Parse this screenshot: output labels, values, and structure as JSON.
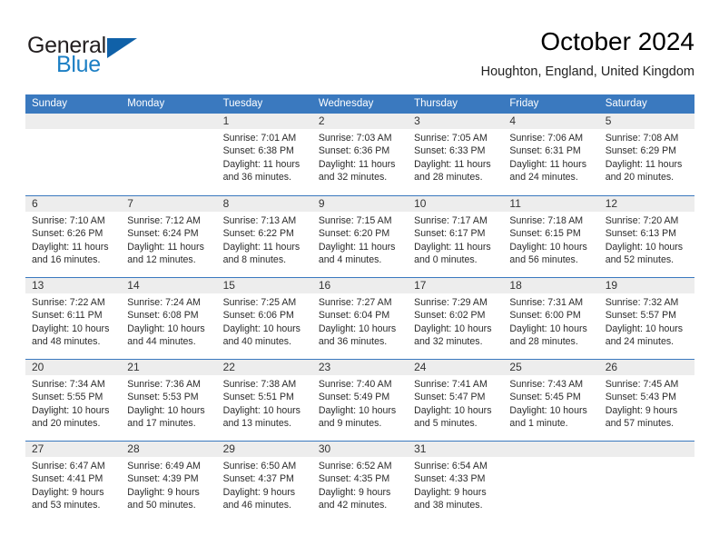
{
  "logo": {
    "word_top": "General",
    "word_bottom": "Blue",
    "triangle_color": "#1061a8",
    "blue_color": "#1c7fc4",
    "dark_color": "#231f20"
  },
  "header": {
    "title": "October 2024",
    "subtitle": "Houghton, England, United Kingdom"
  },
  "theme": {
    "header_blue": "#3a79bf",
    "day_band_gray": "#ededed",
    "text_color": "#2b2b2b"
  },
  "calendar": {
    "weekdays": [
      "Sunday",
      "Monday",
      "Tuesday",
      "Wednesday",
      "Thursday",
      "Friday",
      "Saturday"
    ],
    "weeks": [
      [
        {
          "day": "",
          "empty": true,
          "lines": []
        },
        {
          "day": "",
          "empty": true,
          "lines": []
        },
        {
          "day": "1",
          "empty": false,
          "lines": [
            "Sunrise: 7:01 AM",
            "Sunset: 6:38 PM",
            "Daylight: 11 hours",
            "and 36 minutes."
          ]
        },
        {
          "day": "2",
          "empty": false,
          "lines": [
            "Sunrise: 7:03 AM",
            "Sunset: 6:36 PM",
            "Daylight: 11 hours",
            "and 32 minutes."
          ]
        },
        {
          "day": "3",
          "empty": false,
          "lines": [
            "Sunrise: 7:05 AM",
            "Sunset: 6:33 PM",
            "Daylight: 11 hours",
            "and 28 minutes."
          ]
        },
        {
          "day": "4",
          "empty": false,
          "lines": [
            "Sunrise: 7:06 AM",
            "Sunset: 6:31 PM",
            "Daylight: 11 hours",
            "and 24 minutes."
          ]
        },
        {
          "day": "5",
          "empty": false,
          "lines": [
            "Sunrise: 7:08 AM",
            "Sunset: 6:29 PM",
            "Daylight: 11 hours",
            "and 20 minutes."
          ]
        }
      ],
      [
        {
          "day": "6",
          "empty": false,
          "lines": [
            "Sunrise: 7:10 AM",
            "Sunset: 6:26 PM",
            "Daylight: 11 hours",
            "and 16 minutes."
          ]
        },
        {
          "day": "7",
          "empty": false,
          "lines": [
            "Sunrise: 7:12 AM",
            "Sunset: 6:24 PM",
            "Daylight: 11 hours",
            "and 12 minutes."
          ]
        },
        {
          "day": "8",
          "empty": false,
          "lines": [
            "Sunrise: 7:13 AM",
            "Sunset: 6:22 PM",
            "Daylight: 11 hours",
            "and 8 minutes."
          ]
        },
        {
          "day": "9",
          "empty": false,
          "lines": [
            "Sunrise: 7:15 AM",
            "Sunset: 6:20 PM",
            "Daylight: 11 hours",
            "and 4 minutes."
          ]
        },
        {
          "day": "10",
          "empty": false,
          "lines": [
            "Sunrise: 7:17 AM",
            "Sunset: 6:17 PM",
            "Daylight: 11 hours",
            "and 0 minutes."
          ]
        },
        {
          "day": "11",
          "empty": false,
          "lines": [
            "Sunrise: 7:18 AM",
            "Sunset: 6:15 PM",
            "Daylight: 10 hours",
            "and 56 minutes."
          ]
        },
        {
          "day": "12",
          "empty": false,
          "lines": [
            "Sunrise: 7:20 AM",
            "Sunset: 6:13 PM",
            "Daylight: 10 hours",
            "and 52 minutes."
          ]
        }
      ],
      [
        {
          "day": "13",
          "empty": false,
          "lines": [
            "Sunrise: 7:22 AM",
            "Sunset: 6:11 PM",
            "Daylight: 10 hours",
            "and 48 minutes."
          ]
        },
        {
          "day": "14",
          "empty": false,
          "lines": [
            "Sunrise: 7:24 AM",
            "Sunset: 6:08 PM",
            "Daylight: 10 hours",
            "and 44 minutes."
          ]
        },
        {
          "day": "15",
          "empty": false,
          "lines": [
            "Sunrise: 7:25 AM",
            "Sunset: 6:06 PM",
            "Daylight: 10 hours",
            "and 40 minutes."
          ]
        },
        {
          "day": "16",
          "empty": false,
          "lines": [
            "Sunrise: 7:27 AM",
            "Sunset: 6:04 PM",
            "Daylight: 10 hours",
            "and 36 minutes."
          ]
        },
        {
          "day": "17",
          "empty": false,
          "lines": [
            "Sunrise: 7:29 AM",
            "Sunset: 6:02 PM",
            "Daylight: 10 hours",
            "and 32 minutes."
          ]
        },
        {
          "day": "18",
          "empty": false,
          "lines": [
            "Sunrise: 7:31 AM",
            "Sunset: 6:00 PM",
            "Daylight: 10 hours",
            "and 28 minutes."
          ]
        },
        {
          "day": "19",
          "empty": false,
          "lines": [
            "Sunrise: 7:32 AM",
            "Sunset: 5:57 PM",
            "Daylight: 10 hours",
            "and 24 minutes."
          ]
        }
      ],
      [
        {
          "day": "20",
          "empty": false,
          "lines": [
            "Sunrise: 7:34 AM",
            "Sunset: 5:55 PM",
            "Daylight: 10 hours",
            "and 20 minutes."
          ]
        },
        {
          "day": "21",
          "empty": false,
          "lines": [
            "Sunrise: 7:36 AM",
            "Sunset: 5:53 PM",
            "Daylight: 10 hours",
            "and 17 minutes."
          ]
        },
        {
          "day": "22",
          "empty": false,
          "lines": [
            "Sunrise: 7:38 AM",
            "Sunset: 5:51 PM",
            "Daylight: 10 hours",
            "and 13 minutes."
          ]
        },
        {
          "day": "23",
          "empty": false,
          "lines": [
            "Sunrise: 7:40 AM",
            "Sunset: 5:49 PM",
            "Daylight: 10 hours",
            "and 9 minutes."
          ]
        },
        {
          "day": "24",
          "empty": false,
          "lines": [
            "Sunrise: 7:41 AM",
            "Sunset: 5:47 PM",
            "Daylight: 10 hours",
            "and 5 minutes."
          ]
        },
        {
          "day": "25",
          "empty": false,
          "lines": [
            "Sunrise: 7:43 AM",
            "Sunset: 5:45 PM",
            "Daylight: 10 hours",
            "and 1 minute."
          ]
        },
        {
          "day": "26",
          "empty": false,
          "lines": [
            "Sunrise: 7:45 AM",
            "Sunset: 5:43 PM",
            "Daylight: 9 hours",
            "and 57 minutes."
          ]
        }
      ],
      [
        {
          "day": "27",
          "empty": false,
          "lines": [
            "Sunrise: 6:47 AM",
            "Sunset: 4:41 PM",
            "Daylight: 9 hours",
            "and 53 minutes."
          ]
        },
        {
          "day": "28",
          "empty": false,
          "lines": [
            "Sunrise: 6:49 AM",
            "Sunset: 4:39 PM",
            "Daylight: 9 hours",
            "and 50 minutes."
          ]
        },
        {
          "day": "29",
          "empty": false,
          "lines": [
            "Sunrise: 6:50 AM",
            "Sunset: 4:37 PM",
            "Daylight: 9 hours",
            "and 46 minutes."
          ]
        },
        {
          "day": "30",
          "empty": false,
          "lines": [
            "Sunrise: 6:52 AM",
            "Sunset: 4:35 PM",
            "Daylight: 9 hours",
            "and 42 minutes."
          ]
        },
        {
          "day": "31",
          "empty": false,
          "lines": [
            "Sunrise: 6:54 AM",
            "Sunset: 4:33 PM",
            "Daylight: 9 hours",
            "and 38 minutes."
          ]
        },
        {
          "day": "",
          "empty": true,
          "lines": []
        },
        {
          "day": "",
          "empty": true,
          "lines": []
        }
      ]
    ]
  }
}
